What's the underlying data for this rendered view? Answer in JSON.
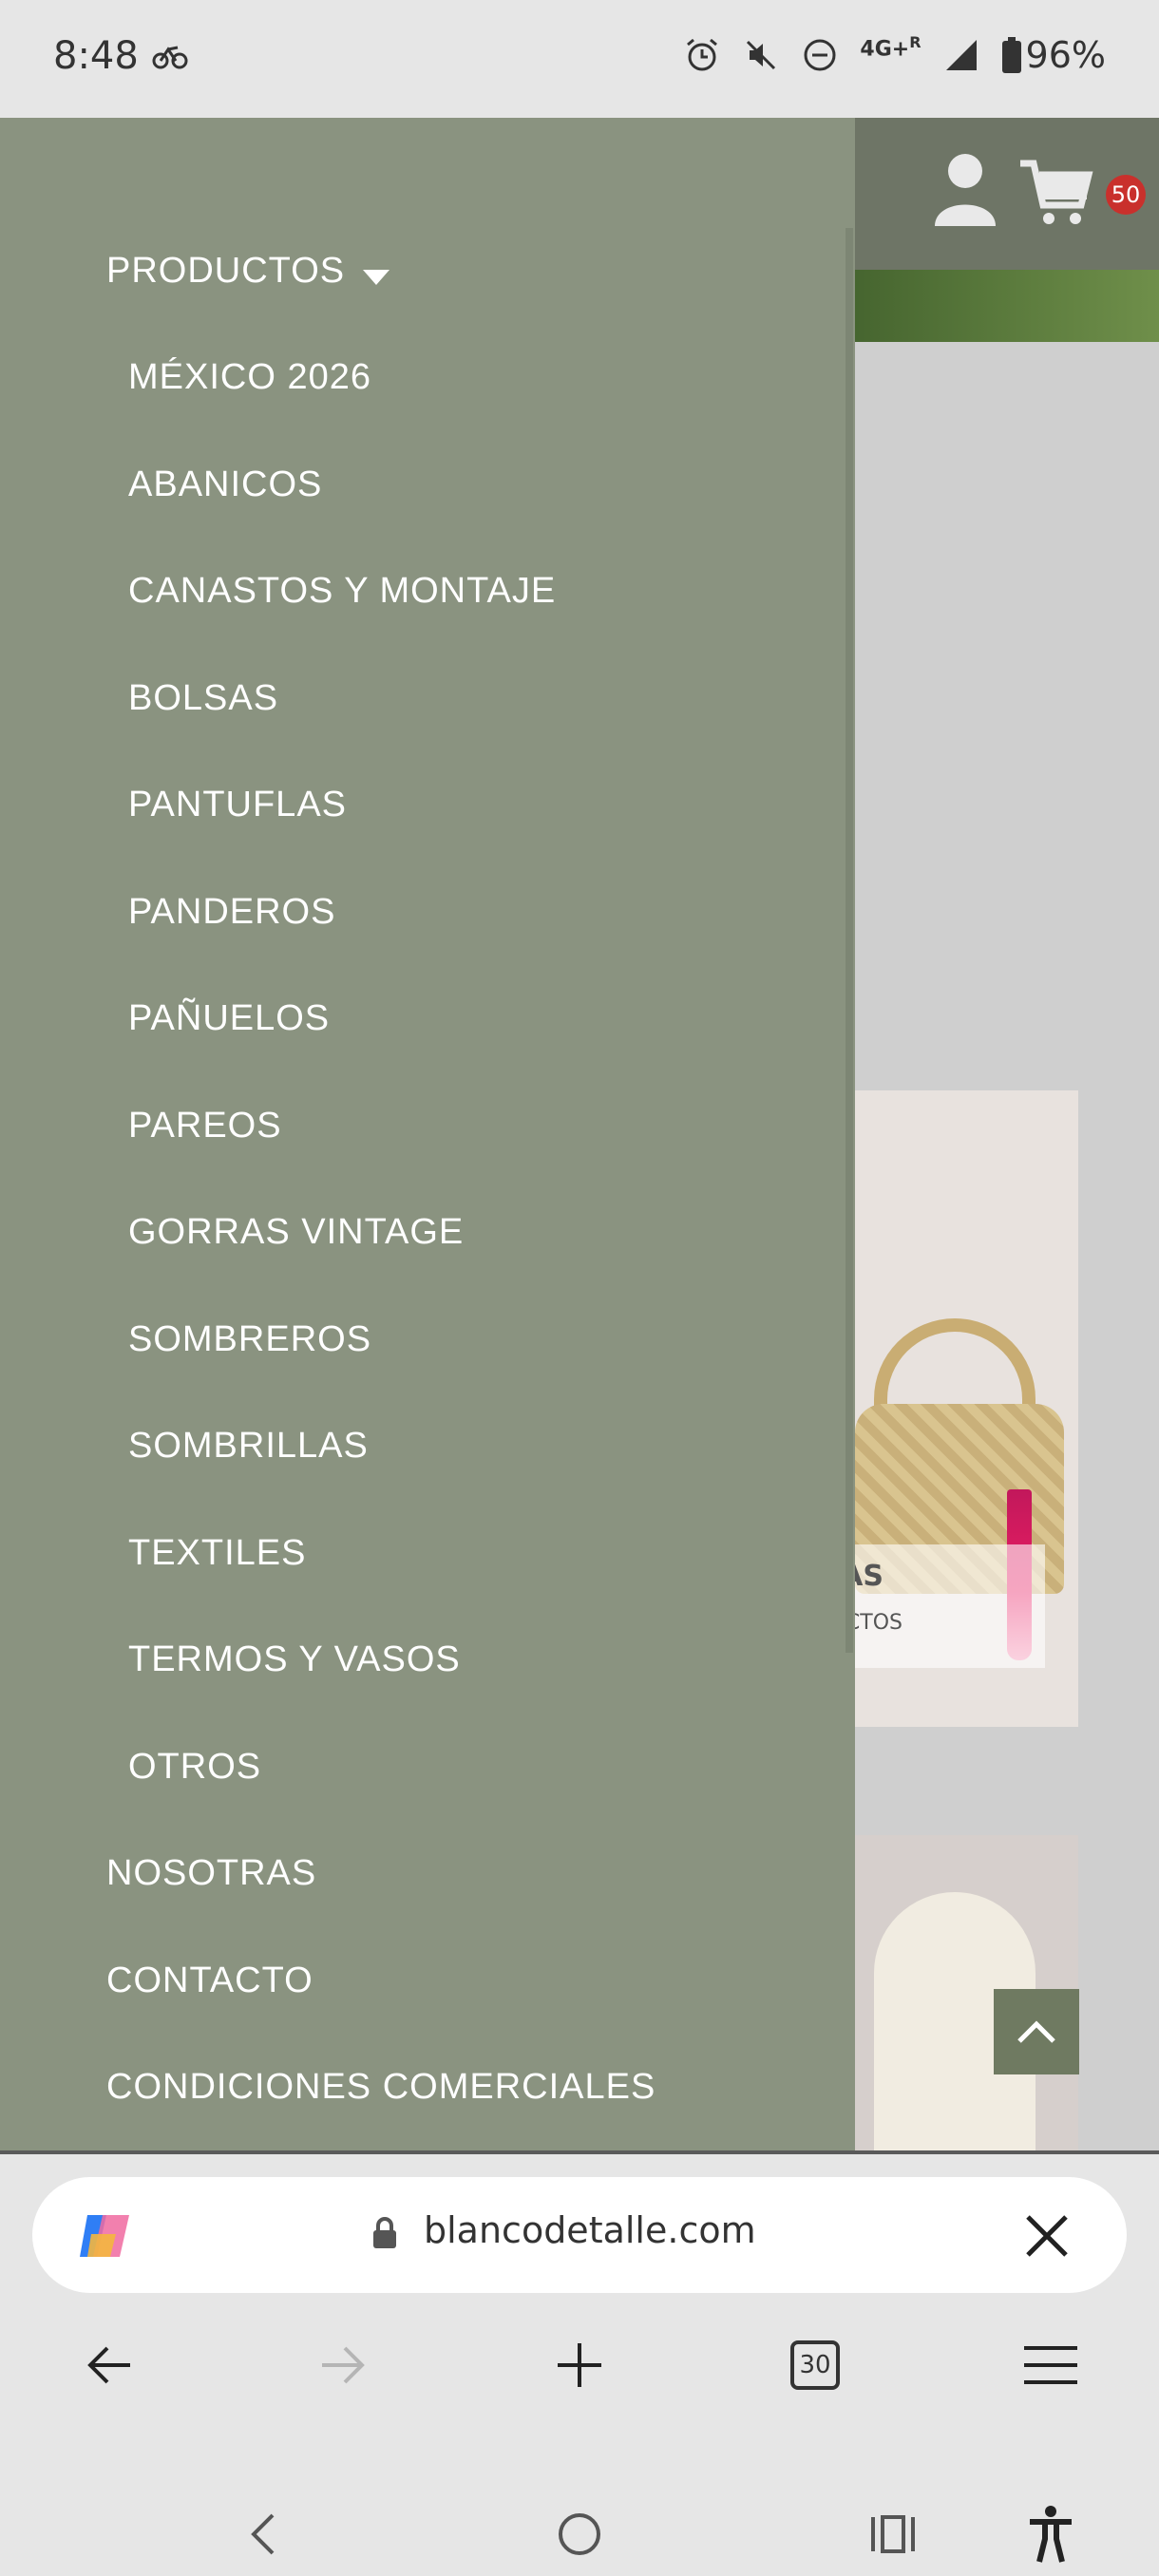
{
  "status_bar": {
    "time": "8:48",
    "network": "4G+",
    "roaming": "R",
    "battery": "96%",
    "icons": [
      "bike-icon",
      "alarm-icon",
      "mute-icon",
      "dnd-icon",
      "signal-icon",
      "battery-icon"
    ]
  },
  "site": {
    "cart_count": "50",
    "card_bolsas": {
      "title": "BOLSAS",
      "subtitle": "PRODUCTOS"
    },
    "icons": [
      "user-icon",
      "cart-icon",
      "chevron-up-icon"
    ]
  },
  "menu": {
    "productos": "PRODUCTOS",
    "categories": [
      "MÉXICO 2026",
      "ABANICOS",
      "CANASTOS Y MONTAJE",
      "BOLSAS",
      "PANTUFLAS",
      "PANDEROS",
      "PAÑUELOS",
      "PAREOS",
      "GORRAS VINTAGE",
      "SOMBREROS",
      "SOMBRILLAS",
      "TEXTILES",
      "TERMOS Y VASOS",
      "OTROS"
    ],
    "nosotras": "NOSOTRAS",
    "contacto": "CONTACTO",
    "condiciones": "CONDICIONES COMERCIALES"
  },
  "browser": {
    "url": "blancodetalle.com",
    "tabs_count": "30",
    "icons": [
      "copilot-icon",
      "lock-icon",
      "close-icon",
      "back-icon",
      "forward-icon",
      "new-tab-icon",
      "tabs-icon",
      "menu-icon"
    ]
  },
  "system_nav": {
    "icons": [
      "system-back-icon",
      "home-icon",
      "recents-icon",
      "accessibility-icon"
    ]
  },
  "colors": {
    "menu_bg": "#8a9380",
    "header_bg": "#6e7566",
    "badge": "#c9302c"
  }
}
